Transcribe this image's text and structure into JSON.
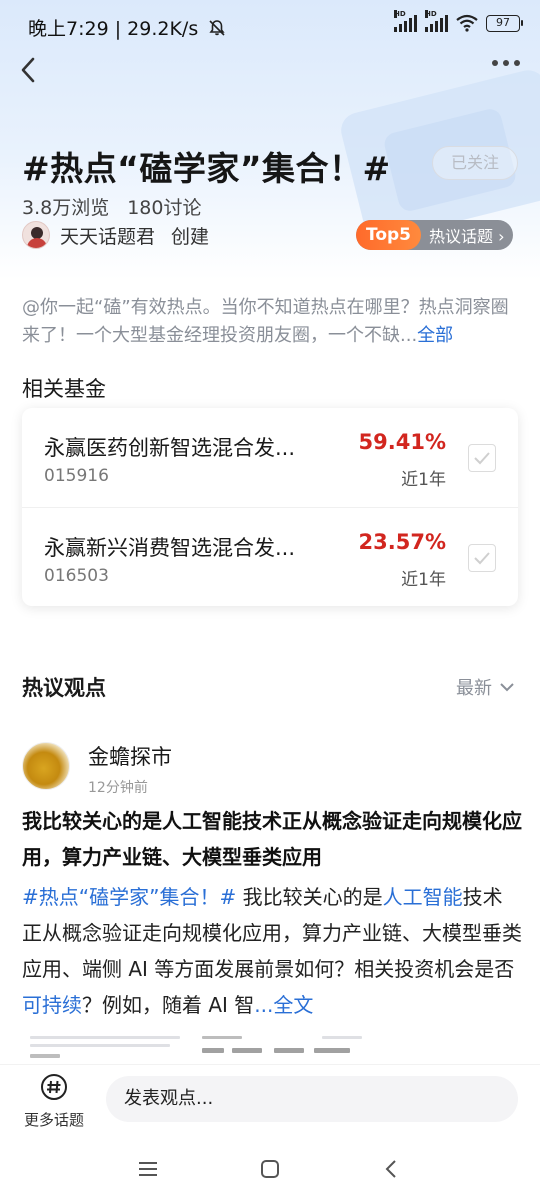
{
  "status_bar": {
    "time_speed": "晚上7:29 | 29.2K/s",
    "battery": "97",
    "signal_labels": [
      "HD",
      "HD"
    ]
  },
  "header": {
    "title": "#热点“磕学家”集合！#",
    "follow_label": "已关注",
    "views": "3.8万浏览",
    "discussions": "180讨论",
    "creator_name": "天天话题君",
    "creator_action": "创建",
    "rank_badge": "Top5",
    "rank_text": "热议话题 ›"
  },
  "description": {
    "text": "@你一起“磕”有效热点。当你不知道热点在哪里？热点洞察圈来了！一个大型基金经理投资朋友圈，一个不缺...",
    "more_label": "全部"
  },
  "related_funds": {
    "title": "相关基金",
    "items": [
      {
        "name": "永赢医药创新智选混合发...",
        "code": "015916",
        "return": "59.41%",
        "period": "近1年"
      },
      {
        "name": "永赢新兴消费智选混合发...",
        "code": "016503",
        "return": "23.57%",
        "period": "近1年"
      }
    ]
  },
  "hot_views": {
    "title": "热议观点",
    "sort_label": "最新"
  },
  "post": {
    "author": "金蟾探市",
    "time": "12分钟前",
    "title": "我比较关心的是人工智能技术正从概念验证走向规模化应用，算力产业链、大模型垂类应用",
    "topic_tag": "#热点“磕学家”集合！#",
    "body_part1": " 我比较关心的是",
    "link1": "人工智能",
    "body_part2": "技术正从概念验证走向规模化应用，算力产业链、大模型垂类应用、端侧 AI 等方面发展前景如何？相关投资机会是否",
    "link2": "可持续",
    "body_part3": "？例如，随着 AI 智",
    "full_text_label": "...全文"
  },
  "bottom_bar": {
    "more_topics_label": "更多话题",
    "input_placeholder": "发表观点..."
  },
  "colors": {
    "accent_blue": "#2a6fd6",
    "return_red": "#d2261f",
    "rank_orange": "#ff6a2b"
  }
}
